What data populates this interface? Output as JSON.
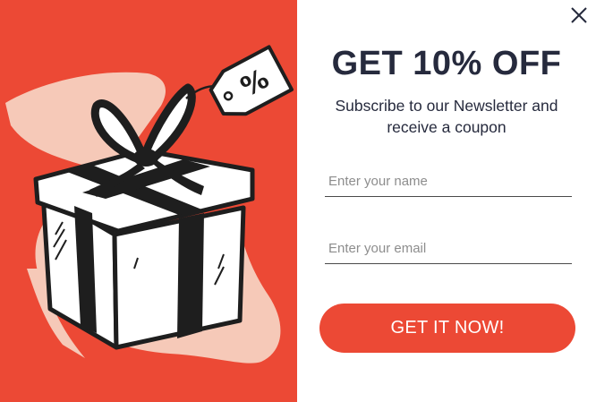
{
  "popup": {
    "title": "GET 10% OFF",
    "subtitle": "Subscribe to our Newsletter and receive a coupon",
    "close_icon": "close-icon",
    "name_field": {
      "placeholder": "Enter your name",
      "value": ""
    },
    "email_field": {
      "placeholder": "Enter your email",
      "value": ""
    },
    "cta_label": "GET IT NOW!",
    "tag_text": "%"
  },
  "colors": {
    "accent": "#ec4935",
    "blob": "#f6c9b8",
    "title_text": "#262a3d",
    "ink": "#1e1e1e"
  }
}
